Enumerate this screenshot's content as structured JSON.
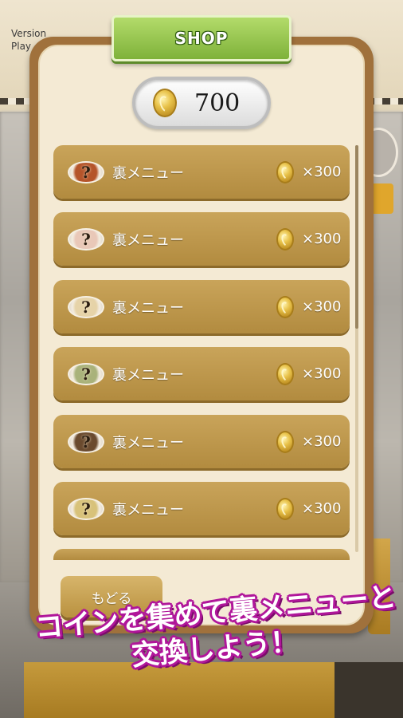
{
  "app": {
    "version_text": "Version",
    "player_text": "Play"
  },
  "shop": {
    "title": "SHOP",
    "balance": "700",
    "items": [
      {
        "label": "裏メニュー",
        "price": "×300",
        "dish_icon": "mystery-dish-icon",
        "dish_color": "#b5542a",
        "mark": "?"
      },
      {
        "label": "裏メニュー",
        "price": "×300",
        "dish_icon": "mystery-dish-icon",
        "dish_color": "#e9c8b8",
        "mark": "?"
      },
      {
        "label": "裏メニュー",
        "price": "×300",
        "dish_icon": "mystery-dish-icon",
        "dish_color": "#e6d3a8",
        "mark": "?"
      },
      {
        "label": "裏メニュー",
        "price": "×300",
        "dish_icon": "mystery-dish-icon",
        "dish_color": "#a9b27a",
        "mark": "?"
      },
      {
        "label": "裏メニュー",
        "price": "×300",
        "dish_icon": "mystery-dish-icon",
        "dish_color": "#6a4a2e",
        "mark": "?"
      },
      {
        "label": "裏メニュー",
        "price": "×300",
        "dish_icon": "mystery-dish-icon",
        "dish_color": "#d8c27a",
        "mark": "?"
      }
    ],
    "back_label": "もどる"
  },
  "promo": {
    "line1": "コインを集めて裏メニューと",
    "line2": "交換しよう！"
  },
  "colors": {
    "panel_border": "#a0713c",
    "panel_bg": "#f4ead4",
    "row_gold": "#c9a45a",
    "tab_green": "#8fc043",
    "promo_magenta": "#b0169a"
  }
}
